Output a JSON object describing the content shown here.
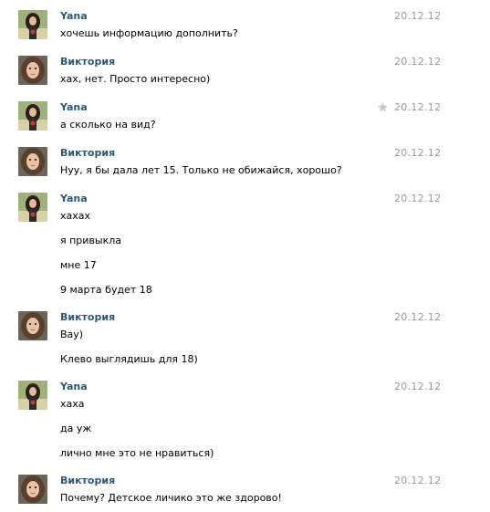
{
  "colors": {
    "author": "#2b587a",
    "date": "#999999",
    "text": "#000000",
    "star": "#c7c7c7"
  },
  "messages": [
    {
      "author": "Yana",
      "avatar_icon": "yana-avatar-icon",
      "date": "20.12.12",
      "lines": [
        "хочешь информацию дополнить?"
      ]
    },
    {
      "author": "Виктория",
      "avatar_icon": "viktoria-avatar-icon",
      "date": "20.12.12",
      "lines": [
        "хах, нет. Просто интересно)"
      ]
    },
    {
      "author": "Yana",
      "avatar_icon": "yana-avatar-icon",
      "date": "20.12.12",
      "star_icon": "star-icon",
      "lines": [
        "а сколько на вид?"
      ]
    },
    {
      "author": "Виктория",
      "avatar_icon": "viktoria-avatar-icon",
      "date": "20.12.12",
      "lines": [
        "Нуу, я бы дала лет 15. Только не обижайся, хорошо?"
      ]
    },
    {
      "author": "Yana",
      "avatar_icon": "yana-avatar-icon",
      "date": "20.12.12",
      "lines": [
        "хахах",
        "я привыкла",
        "мне 17",
        "9 марта будет 18"
      ]
    },
    {
      "author": "Виктория",
      "avatar_icon": "viktoria-avatar-icon",
      "date": "20.12.12",
      "lines": [
        "Вау)",
        "Клево выглядишь для 18)"
      ]
    },
    {
      "author": "Yana",
      "avatar_icon": "yana-avatar-icon",
      "date": "20.12.12",
      "lines": [
        "хаха",
        "да уж",
        "лично мне это не нравиться)"
      ]
    },
    {
      "author": "Виктория",
      "avatar_icon": "viktoria-avatar-icon",
      "date": "20.12.12",
      "lines": [
        "Почему? Детское личико это же здорово!"
      ]
    }
  ]
}
